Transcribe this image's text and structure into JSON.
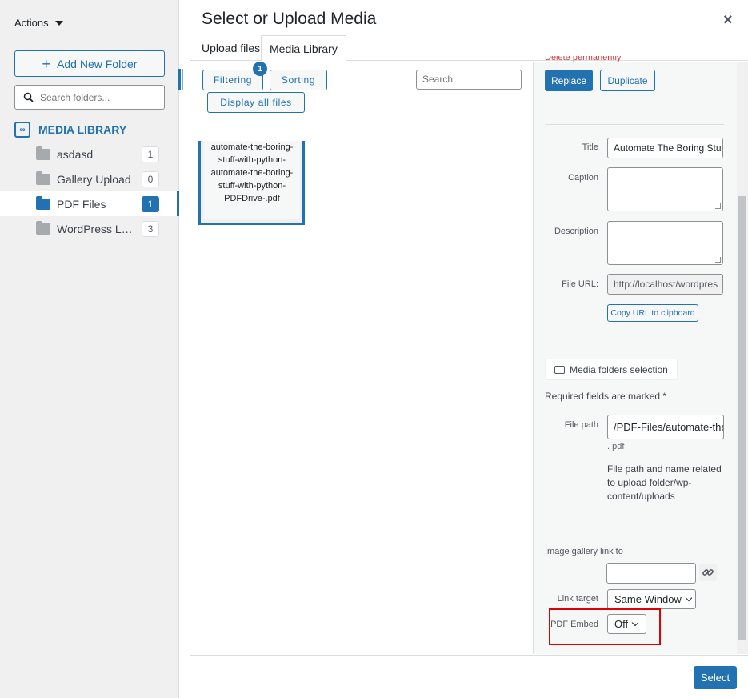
{
  "sidebar": {
    "actions_label": "Actions",
    "add_folder_label": "Add New Folder",
    "search_placeholder": "Search folders...",
    "library_label": "MEDIA LIBRARY",
    "folders": [
      {
        "label": "asdasd",
        "count": "1"
      },
      {
        "label": "Gallery Upload",
        "count": "0"
      },
      {
        "label": "PDF Files",
        "count": "1",
        "active": true
      },
      {
        "label": "WordPress Log...",
        "count": "3"
      }
    ]
  },
  "modal": {
    "title": "Select or Upload Media",
    "close_glyph": "×",
    "tabs": [
      {
        "label": "Upload files"
      },
      {
        "label": "Media Library",
        "active": true
      }
    ]
  },
  "toolbar": {
    "filtering_label": "Filtering",
    "filter_badge": "1",
    "sorting_label": "Sorting",
    "display_all_label": "Display all files",
    "search_placeholder": "Search"
  },
  "attachment": {
    "name": "automate-the-boring-stuff-with-python-automate-the-boring-stuff-with-python-PDFDrive-.pdf"
  },
  "details": {
    "delete_permanently": "Delete permanently",
    "replace_label": "Replace",
    "duplicate_label": "Duplicate",
    "title_label": "Title",
    "title_value": "Automate The Boring Stu",
    "caption_label": "Caption",
    "description_label": "Description",
    "file_url_label": "File URL:",
    "file_url_value": "http://localhost/wordpres",
    "copy_url_label": "Copy URL to clipboard",
    "folders_selection_label": "Media folders selection",
    "required_note": "Required fields are marked *",
    "file_path_label": "File path",
    "file_path_value": "/PDF-Files/automate-the",
    "file_ext": ". pdf",
    "file_path_help": "File path and name related to upload folder/wp-content/uploads",
    "gallery_link_label": "Image gallery link to",
    "gallery_link_value": "",
    "link_target_label": "Link target",
    "link_target_value": "Same Window",
    "pdf_embed_label": "PDF Embed",
    "pdf_embed_value": "Off"
  },
  "footer": {
    "select_label": "Select"
  },
  "colors": {
    "accent": "#2271b1",
    "highlight": "#e00000"
  }
}
